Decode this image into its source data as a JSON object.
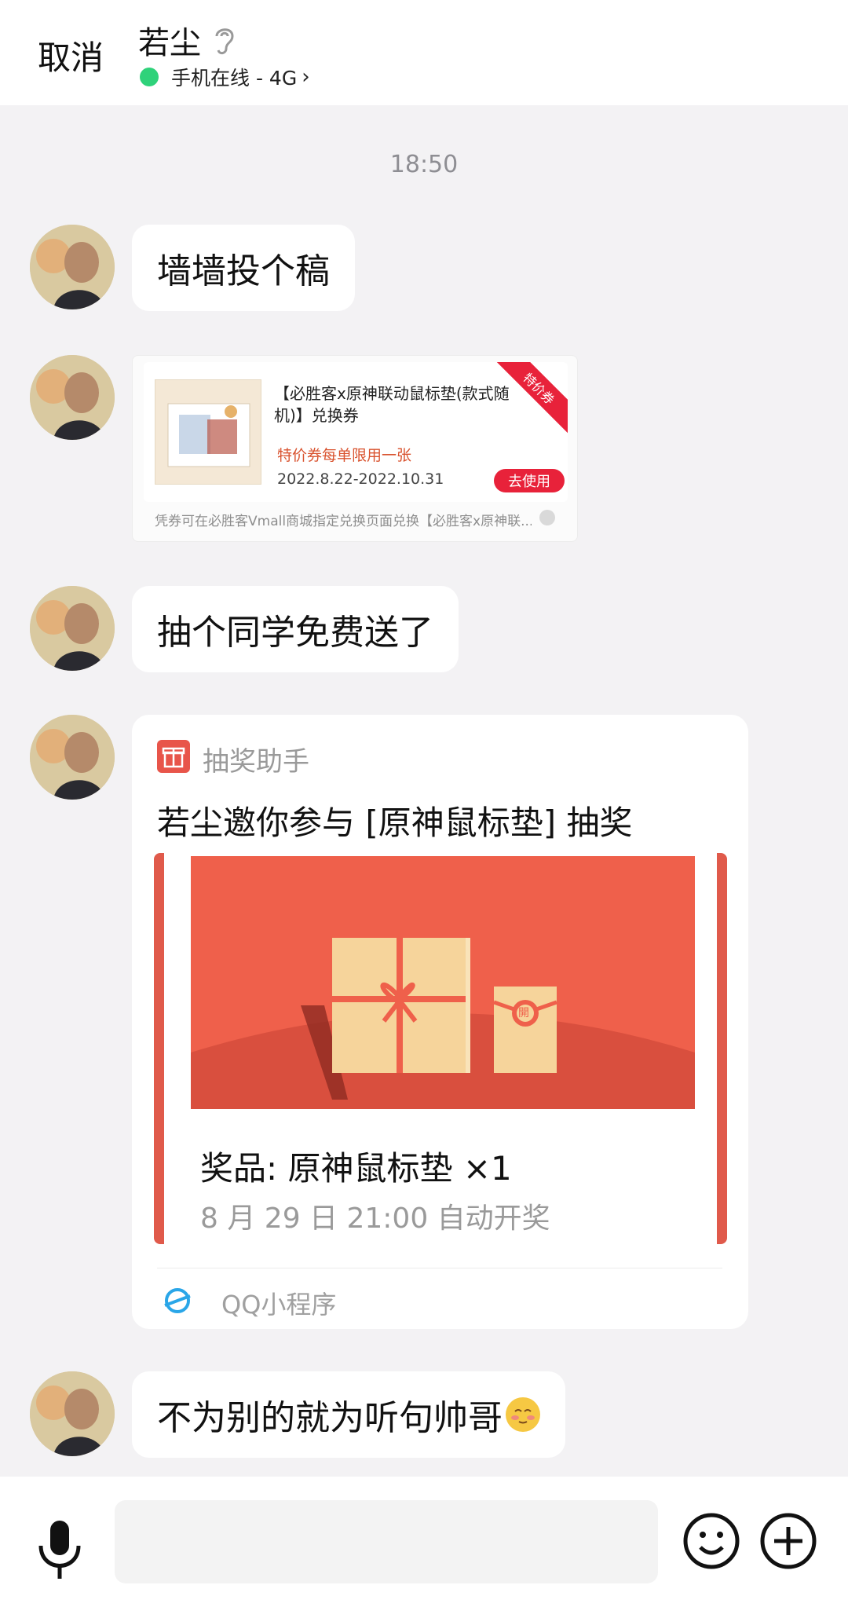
{
  "header": {
    "cancel_label": "取消",
    "contact_name": "若尘",
    "status_text": "手机在线 - 4G",
    "status_color": "#2fd27a"
  },
  "timestamp": "18:50",
  "messages": [
    {
      "text": "墙墙投个稿"
    },
    {
      "text": "抽个同学免费送了"
    },
    {
      "text": "不为别的就为听句帅哥"
    }
  ],
  "coupon": {
    "title": "【必胜客x原神联动鼠标垫(款式随机)】兑换券",
    "ribbon": "特价券",
    "limit_text": "特价券每单限用一张",
    "date_range": "2022.8.22-2022.10.31",
    "use_button": "去使用",
    "footer": "凭券可在必胜客Vmall商城指定兑换页面兑换【必胜客x原神联..."
  },
  "lottery_card": {
    "app_name": "抽奖助手",
    "title": "若尘邀你参与 [原神鼠标垫] 抽奖",
    "banner_seal": "開",
    "prize": "奖品: 原神鼠标垫 ×1",
    "draw_time": "8 月 29 日 21:00 自动开奖",
    "footer_label": "QQ小程序",
    "accent_color": "#e05a4b"
  },
  "input_bar": {
    "icons": [
      "mic-icon",
      "emoji-icon",
      "plus-icon"
    ]
  }
}
